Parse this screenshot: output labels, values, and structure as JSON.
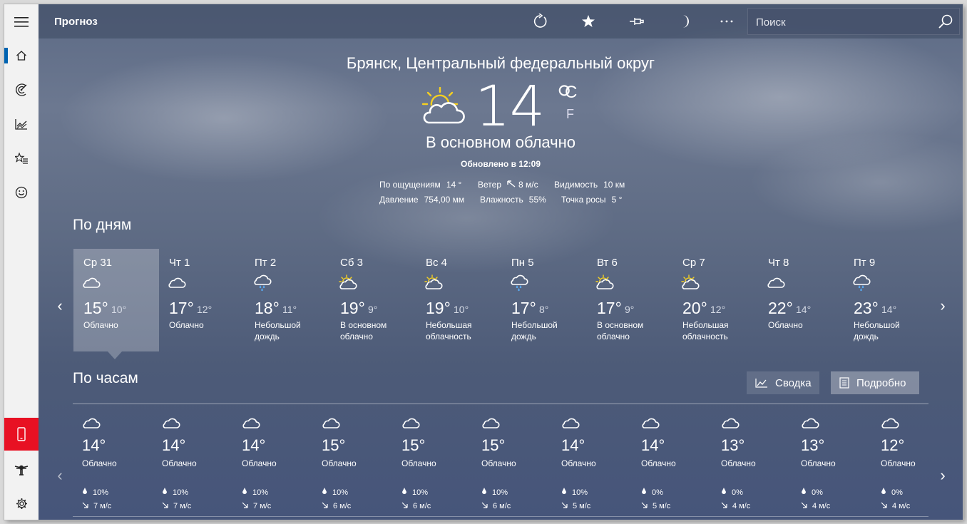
{
  "app": {
    "title": "Прогноз"
  },
  "search": {
    "placeholder": "Поиск"
  },
  "current": {
    "location": "Брянск, Центральный федеральный округ",
    "temperature": "14",
    "degree": "°",
    "unit_c": "C",
    "unit_f": "F",
    "condition": "В основном облачно",
    "updated": "Обновлено в 12:09",
    "stats": [
      {
        "label": "По ощущениям",
        "value": "14 °"
      },
      {
        "label": "Ветер",
        "value": "8 м/с"
      },
      {
        "label": "Видимость",
        "value": "10 км"
      },
      {
        "label": "Давление",
        "value": "754,00 мм"
      },
      {
        "label": "Влажность",
        "value": "55%"
      },
      {
        "label": "Точка росы",
        "value": "5 °"
      }
    ]
  },
  "daily": {
    "title": "По дням",
    "selected_index": 0,
    "days": [
      {
        "name": "Ср 31",
        "icon": "cloud",
        "high": "15°",
        "low": "10°",
        "desc": "Облачно"
      },
      {
        "name": "Чт 1",
        "icon": "cloud",
        "high": "17°",
        "low": "12°",
        "desc": "Облачно"
      },
      {
        "name": "Пт 2",
        "icon": "rain",
        "high": "18°",
        "low": "11°",
        "desc": "Небольшой дождь"
      },
      {
        "name": "Сб 3",
        "icon": "partly-sunny",
        "high": "19°",
        "low": "9°",
        "desc": "В основном облачно"
      },
      {
        "name": "Вс 4",
        "icon": "partly-sunny",
        "high": "19°",
        "low": "10°",
        "desc": "Небольшая облачность"
      },
      {
        "name": "Пн 5",
        "icon": "rain",
        "high": "17°",
        "low": "8°",
        "desc": "Небольшой дождь"
      },
      {
        "name": "Вт 6",
        "icon": "partly-sunny",
        "high": "17°",
        "low": "9°",
        "desc": "В основном облачно"
      },
      {
        "name": "Ср 7",
        "icon": "partly-sunny",
        "high": "20°",
        "low": "12°",
        "desc": "Небольшая облачность"
      },
      {
        "name": "Чт 8",
        "icon": "cloud",
        "high": "22°",
        "low": "14°",
        "desc": "Облачно"
      },
      {
        "name": "Пт 9",
        "icon": "rain",
        "high": "23°",
        "low": "14°",
        "desc": "Небольшой дождь"
      }
    ]
  },
  "hourly": {
    "title": "По часам",
    "summary_label": "Сводка",
    "detail_label": "Подробно",
    "hours": [
      {
        "icon": "cloud",
        "temp": "14°",
        "desc": "Облачно",
        "precip": "10%",
        "wind": "7 м/с"
      },
      {
        "icon": "cloud",
        "temp": "14°",
        "desc": "Облачно",
        "precip": "10%",
        "wind": "7 м/с"
      },
      {
        "icon": "cloud",
        "temp": "14°",
        "desc": "Облачно",
        "precip": "10%",
        "wind": "7 м/с"
      },
      {
        "icon": "cloud",
        "temp": "15°",
        "desc": "Облачно",
        "precip": "10%",
        "wind": "6 м/с"
      },
      {
        "icon": "cloud",
        "temp": "15°",
        "desc": "Облачно",
        "precip": "10%",
        "wind": "6 м/с"
      },
      {
        "icon": "cloud",
        "temp": "15°",
        "desc": "Облачно",
        "precip": "10%",
        "wind": "6 м/с"
      },
      {
        "icon": "cloud",
        "temp": "14°",
        "desc": "Облачно",
        "precip": "10%",
        "wind": "5 м/с"
      },
      {
        "icon": "cloud",
        "temp": "14°",
        "desc": "Облачно",
        "precip": "0%",
        "wind": "5 м/с"
      },
      {
        "icon": "cloud",
        "temp": "13°",
        "desc": "Облачно",
        "precip": "0%",
        "wind": "4 м/с"
      },
      {
        "icon": "cloud",
        "temp": "13°",
        "desc": "Облачно",
        "precip": "0%",
        "wind": "4 м/с"
      },
      {
        "icon": "cloud",
        "temp": "12°",
        "desc": "Облачно",
        "precip": "0%",
        "wind": "4 м/с"
      }
    ]
  },
  "colors": {
    "accent": "#0063b1",
    "alert": "#e81123",
    "sun": "#f5d020"
  }
}
